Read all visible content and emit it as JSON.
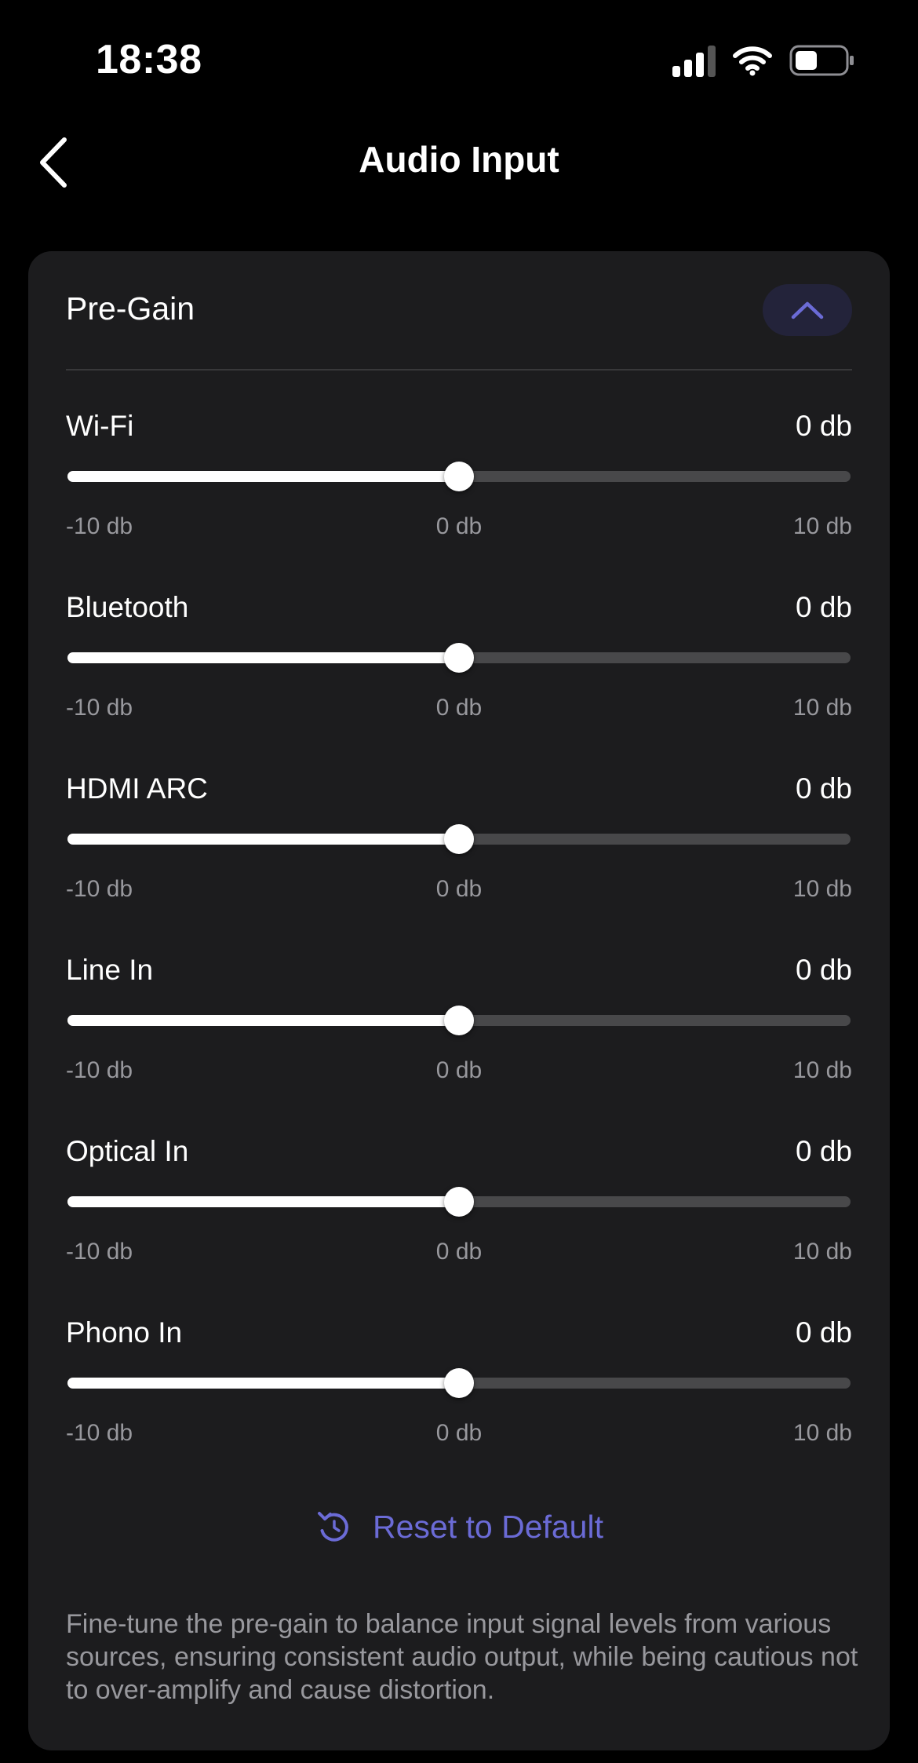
{
  "status_bar": {
    "time": "18:38",
    "icons": [
      "cellular-signal-icon",
      "wifi-icon",
      "battery-icon"
    ],
    "battery_level": 0.45
  },
  "nav": {
    "title": "Audio Input",
    "back_icon": "chevron-left-icon"
  },
  "section": {
    "title": "Pre-Gain",
    "collapse_icon": "chevron-up-icon",
    "sliders": [
      {
        "label": "Wi-Fi",
        "value_text": "0 db",
        "value": 0,
        "min": -10,
        "max": 10,
        "min_label": "-10 db",
        "mid_label": "0 db",
        "max_label": "10 db"
      },
      {
        "label": "Bluetooth",
        "value_text": "0 db",
        "value": 0,
        "min": -10,
        "max": 10,
        "min_label": "-10 db",
        "mid_label": "0 db",
        "max_label": "10 db"
      },
      {
        "label": "HDMI ARC",
        "value_text": "0 db",
        "value": 0,
        "min": -10,
        "max": 10,
        "min_label": "-10 db",
        "mid_label": "0 db",
        "max_label": "10 db"
      },
      {
        "label": "Line In",
        "value_text": "0 db",
        "value": 0,
        "min": -10,
        "max": 10,
        "min_label": "-10 db",
        "mid_label": "0 db",
        "max_label": "10 db"
      },
      {
        "label": "Optical In",
        "value_text": "0 db",
        "value": 0,
        "min": -10,
        "max": 10,
        "min_label": "-10 db",
        "mid_label": "0 db",
        "max_label": "10 db"
      },
      {
        "label": "Phono In",
        "value_text": "0 db",
        "value": 0,
        "min": -10,
        "max": 10,
        "min_label": "-10 db",
        "mid_label": "0 db",
        "max_label": "10 db"
      }
    ],
    "reset_label": "Reset to Default",
    "reset_icon": "reset-icon",
    "description": "Fine-tune the pre-gain to balance input signal levels from various sources, ensuring consistent audio output, while being cautious not to over-amplify and cause distortion."
  },
  "colors": {
    "background": "#000000",
    "card": "#1c1c1e",
    "accent": "#6b6bd6",
    "track": "#48484a",
    "muted_text": "#98989d"
  }
}
